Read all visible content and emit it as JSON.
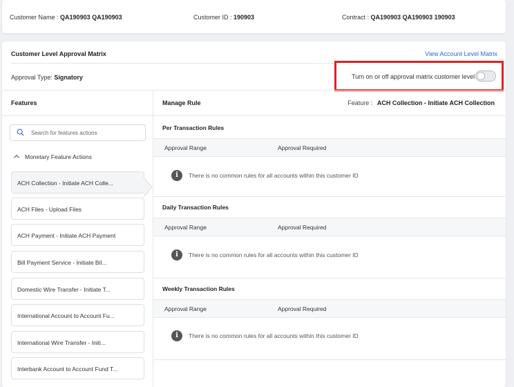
{
  "header": {
    "customer_name_label": "Customer Name :",
    "customer_name_value": "QA190903 QA190903",
    "customer_id_label": "Customer ID :",
    "customer_id_value": "190903",
    "contract_label": "Contract :",
    "contract_value": "QA190903 QA190903 190903"
  },
  "matrix": {
    "title": "Customer Level Approval Matrix",
    "view_account_link": "View Account Level Matrix",
    "approval_type_label": "Approval Type:",
    "approval_type_value": "Signatory",
    "toggle_label": "Turn on or off approval matrix customer level",
    "toggle_state": "off"
  },
  "features_panel": {
    "title": "Features",
    "search_placeholder": "Search for features actions",
    "group_label": "Monetary Feature Actions",
    "items": [
      "ACH Collection - Initiate ACH Colle...",
      "ACH Files - Upload Files",
      "ACH Payment - Initiate ACH Payment",
      "Bill Payment Service - Initiate Bil...",
      "Domestic Wire Transfer - Initiate T...",
      "International Account to Account Fu...",
      "International Wire Transfer - Initi...",
      "Interbank Account to Account Fund T..."
    ]
  },
  "rules_panel": {
    "title": "Manage Rule",
    "feature_label": "Feature :",
    "feature_value": "ACH Collection - Initiate ACH Collection",
    "sections": [
      {
        "title": "Per Transaction Rules",
        "col_range": "Approval Range",
        "col_required": "Approval Required",
        "empty_message": "There is no common rules for all accounts within this customer ID"
      },
      {
        "title": "Daily Transaction Rules",
        "col_range": "Approval Range",
        "col_required": "Approval Required",
        "empty_message": "There is no common rules for all accounts within this customer ID"
      },
      {
        "title": "Weekly Transaction Rules",
        "col_range": "Approval Range",
        "col_required": "Approval Required",
        "empty_message": "There is no common rules for all accounts within this customer ID"
      }
    ]
  },
  "colors": {
    "link": "#2f6bd8",
    "highlight": "#e02020"
  }
}
